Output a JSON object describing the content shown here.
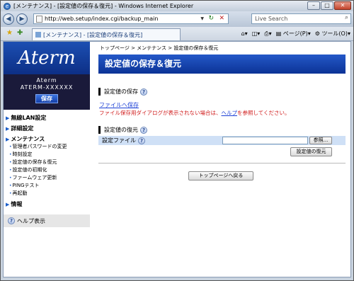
{
  "window": {
    "title": "[メンテナンス] - [設定値の保存＆復元] - Windows Internet Explorer"
  },
  "address": {
    "url": "http://web.setup/index.cgi/backup_main"
  },
  "search": {
    "placeholder": "Live Search"
  },
  "tab": {
    "label": "[メンテナンス] - [設定値の保存＆復元]"
  },
  "toolbar": {
    "page_label": "ページ(P)",
    "tools_label": "ツール(O)"
  },
  "sidebar": {
    "logo": "Aterm",
    "model_line1": "Aterm",
    "model_line2": "ATERM-XXXXXX",
    "save_button": "保存",
    "menu": [
      {
        "label": "無線LAN設定",
        "items": []
      },
      {
        "label": "詳細設定",
        "items": []
      },
      {
        "label": "メンテナンス",
        "items": [
          "管理者パスワードの変更",
          "時刻設定",
          "設定値の保存＆復元",
          "設定値の初期化",
          "ファームウェア更新",
          "PINGテスト",
          "再起動"
        ]
      },
      {
        "label": "情報",
        "items": []
      }
    ],
    "help_label": "ヘルプ表示"
  },
  "main": {
    "breadcrumb": "トップページ > メンテナンス > 設定値の保存＆復元",
    "page_title": "設定値の保存＆復元",
    "save_section": {
      "title": "設定値の保存",
      "link": "ファイルへ保存",
      "note_before": "ファイル保存用ダイアログが表示されない場合は、",
      "note_link": "ヘルプ",
      "note_after": "を参照してください。"
    },
    "restore_section": {
      "title": "設定値の復元",
      "field_label": "設定ファイル",
      "file_value": "",
      "browse_button": "参照...",
      "restore_button": "設定値の復元"
    },
    "top_button": "トップページへ戻る"
  }
}
